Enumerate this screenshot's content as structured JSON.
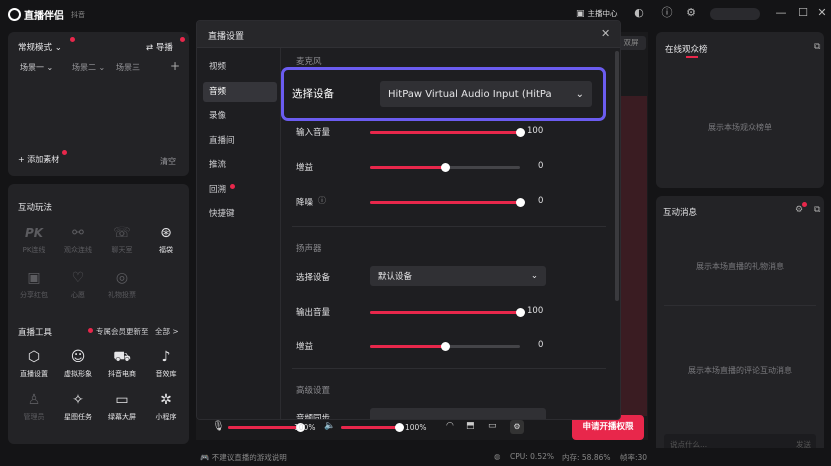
{
  "app": {
    "title": "直播伴侣",
    "subtitle": "抖音"
  },
  "titlebar": {
    "anchor_center": "主播中心",
    "controls": [
      "minimize",
      "maximize",
      "close"
    ]
  },
  "left": {
    "mode": "常规模式",
    "mode_right": "导播",
    "scenes": [
      "场景一",
      "场景二",
      "场景三"
    ],
    "add_material": "添加素材",
    "clear": "清空",
    "interact_title": "互动玩法",
    "interact_items": [
      {
        "label": "PK连线",
        "icon": "PK"
      },
      {
        "label": "观众连线",
        "icon": "link-icon"
      },
      {
        "label": "聊天室",
        "icon": "chat-icon"
      },
      {
        "label": "福袋",
        "icon": "bag-icon"
      },
      {
        "label": "分享红包",
        "icon": "redpack-icon"
      },
      {
        "label": "心愿",
        "icon": "heart-icon"
      },
      {
        "label": "礼物投票",
        "icon": "vote-icon"
      }
    ],
    "tools_title": "直播工具",
    "tools_notice": "专属会员更新至",
    "tools_all": "全部 >",
    "tools_items": [
      {
        "label": "直播设置",
        "icon": "gear-hex-icon"
      },
      {
        "label": "虚拟形象",
        "icon": "avatar-icon"
      },
      {
        "label": "抖音电商",
        "icon": "cart-icon"
      },
      {
        "label": "音效库",
        "icon": "note-icon"
      },
      {
        "label": "管理员",
        "icon": "admin-icon"
      },
      {
        "label": "星图任务",
        "icon": "star-icon"
      },
      {
        "label": "绿幕大屏",
        "icon": "monitor-icon"
      },
      {
        "label": "小程序",
        "icon": "app-icon"
      }
    ]
  },
  "dialog": {
    "title": "直播设置",
    "nav": [
      "视频",
      "音频",
      "录像",
      "直播间",
      "推流",
      "回溯",
      "快捷键"
    ],
    "active_nav": "音频",
    "mic_section": "麦克风",
    "device_label": "选择设备",
    "device_value": "HitPaw Virtual Audio Input (HitPa",
    "input_volume": {
      "label": "输入音量",
      "value": "100",
      "level": 100
    },
    "gain": {
      "label": "增益",
      "value": "0",
      "level": 50
    },
    "noise": {
      "label": "降噪",
      "value": "0",
      "level": 100
    },
    "speaker_section": "扬声器",
    "speaker_device_label": "选择设备",
    "speaker_device_value": "默认设备",
    "output_volume": {
      "label": "输出音量",
      "value": "100",
      "level": 100
    },
    "speaker_gain": {
      "label": "增益",
      "value": "0",
      "level": 50
    },
    "advanced_section": "高级设置",
    "advanced_item": "音频同步"
  },
  "mixer": {
    "mic_pct": "100%",
    "mic_level": 100,
    "spk_pct": "100%",
    "spk_level": 100
  },
  "go_live": "申请开播权限",
  "right": {
    "online_title": "在线观众榜",
    "online_empty": "展示本场观众榜单",
    "msg_title": "互动消息",
    "gift_empty": "展示本场直播的礼物消息",
    "comment_empty": "展示本场直播的评论互动消息",
    "chat_placeholder": "说点什么...",
    "send": "发送",
    "dual": "双屏"
  },
  "status": {
    "tip": "不建议直播的游戏说明",
    "cpu": "CPU: 0.52%",
    "mem": "内存: 58.86%",
    "fps": "帧率:30"
  }
}
